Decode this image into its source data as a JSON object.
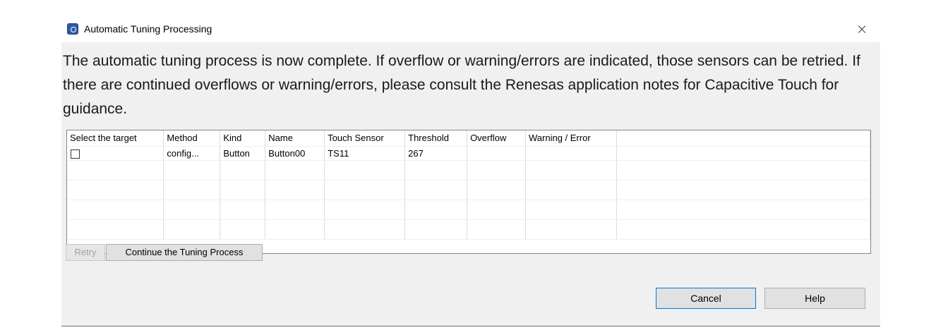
{
  "window": {
    "title": "Automatic Tuning Processing",
    "close_label": "×"
  },
  "message": "The automatic tuning process is now complete. If overflow or warning/errors are indicated, those sensors can be retried. If there are continued overflows or warning/errors, please consult the Renesas application notes for Capacitive Touch for guidance.",
  "table": {
    "columns": [
      "Select the target",
      "Method",
      "Kind",
      "Name",
      "Touch Sensor",
      "Threshold",
      "Overflow",
      "Warning / Error"
    ],
    "rows": [
      {
        "selected": false,
        "method": "config...",
        "kind": "Button",
        "name": "Button00",
        "touch_sensor": "TS11",
        "threshold": "267",
        "overflow": "",
        "warning_error": ""
      }
    ]
  },
  "buttons": {
    "retry": "Retry",
    "continue": "Continue the Tuning Process",
    "cancel": "Cancel",
    "help": "Help"
  }
}
